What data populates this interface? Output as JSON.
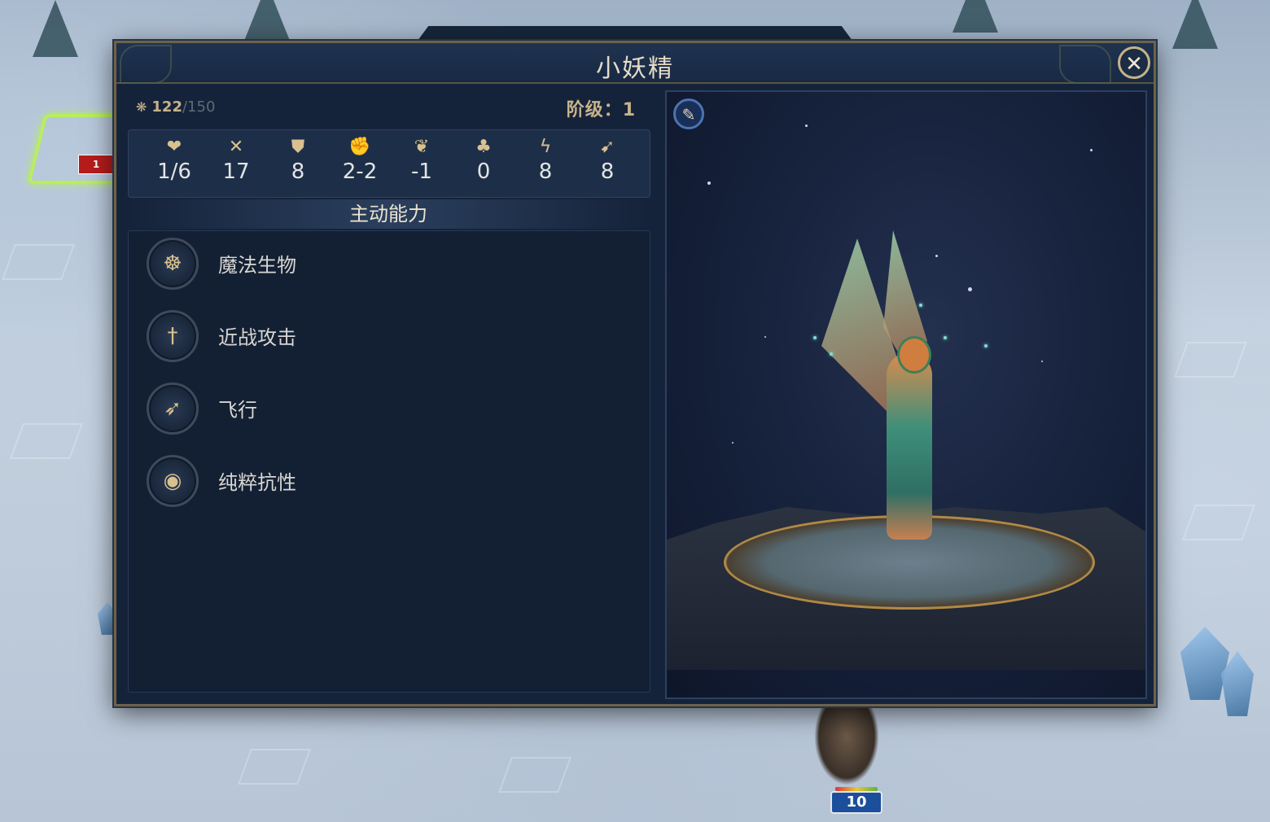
{
  "window": {
    "title": "小妖精",
    "close_symbol": "✕"
  },
  "header": {
    "population_current": "122",
    "population_max": "/150",
    "rank_label": "阶级：",
    "rank_value": "1"
  },
  "stats": [
    {
      "icon": "health-icon",
      "glyph": "❤",
      "value": "1/6"
    },
    {
      "icon": "attack-icon",
      "glyph": "✕",
      "value": "17"
    },
    {
      "icon": "defense-icon",
      "glyph": "⛊",
      "value": "8"
    },
    {
      "icon": "damage-icon",
      "glyph": "✊",
      "value": "2-2"
    },
    {
      "icon": "morale-icon",
      "glyph": "❦",
      "value": "-1"
    },
    {
      "icon": "luck-icon",
      "glyph": "♣",
      "value": "0"
    },
    {
      "icon": "initiative-icon",
      "glyph": "ϟ",
      "value": "8"
    },
    {
      "icon": "speed-icon",
      "glyph": "➹",
      "value": "8"
    }
  ],
  "abilities": {
    "header": "主动能力",
    "items": [
      {
        "label": "魔法生物",
        "icon": "paw-eye-icon",
        "glyph": "☸"
      },
      {
        "label": "近战攻击",
        "icon": "sword-icon",
        "glyph": "†"
      },
      {
        "label": "飞行",
        "icon": "wing-icon",
        "glyph": "➶"
      },
      {
        "label": "纯粹抗性",
        "icon": "resistance-eye-icon",
        "glyph": "◉"
      }
    ]
  },
  "portrait": {
    "feather_glyph": "✎"
  },
  "map": {
    "unit_stack_count": "10",
    "enemy_flag_text": "1"
  }
}
